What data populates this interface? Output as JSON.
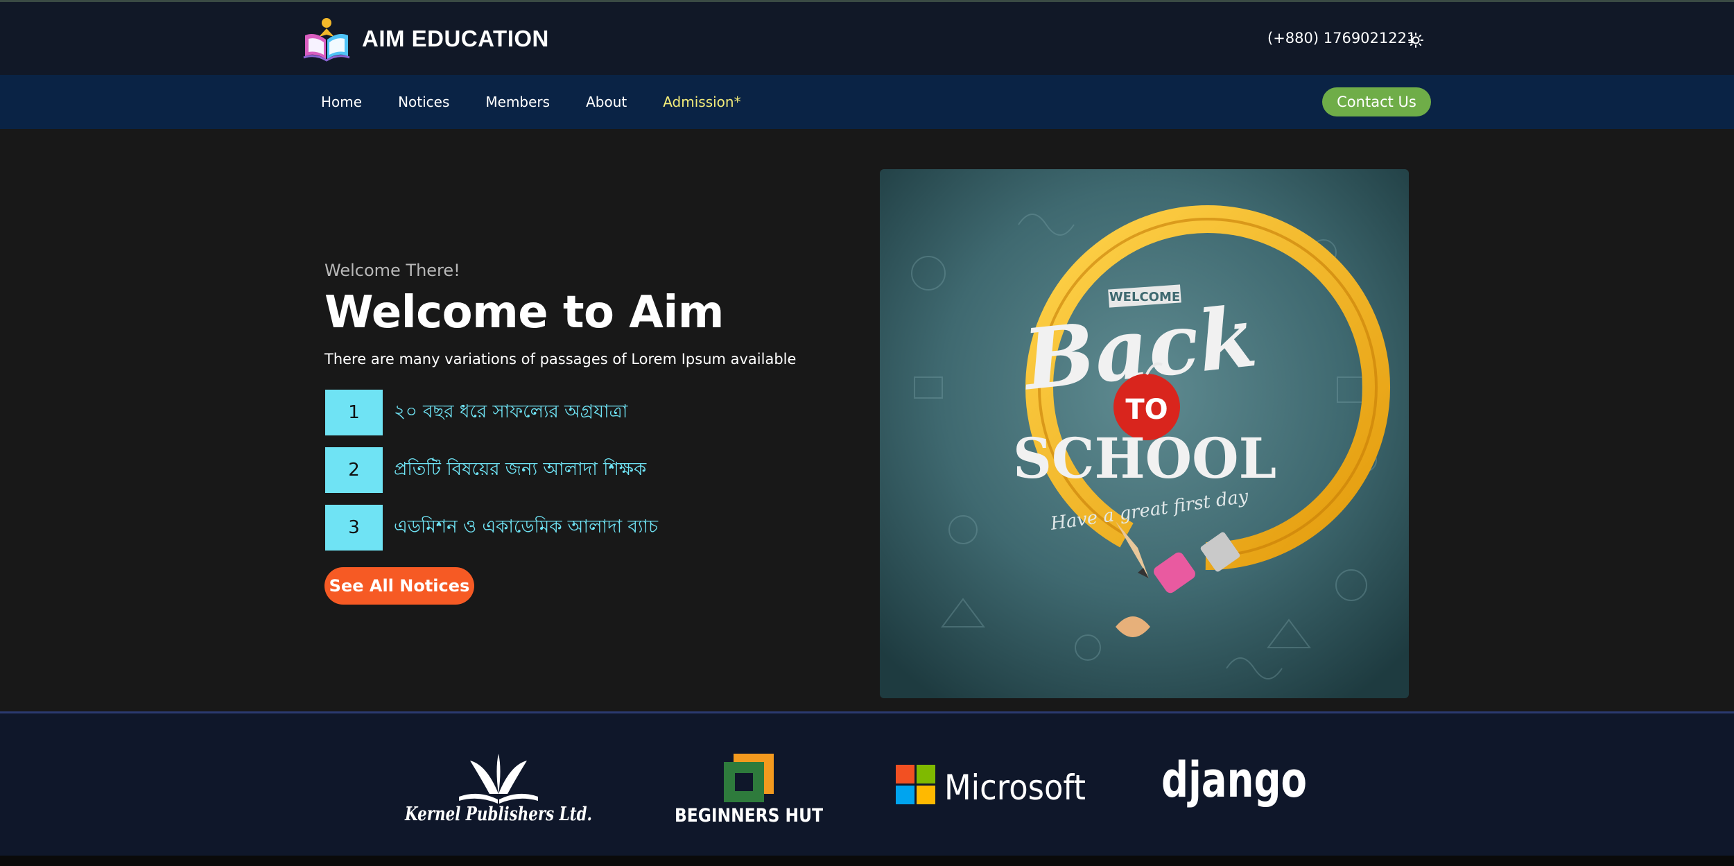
{
  "header": {
    "brand_name": "AIM EDUCATION",
    "phone": "(+880) 1769021221",
    "theme_icon": "sun-icon"
  },
  "nav": {
    "items": [
      {
        "label": "Home"
      },
      {
        "label": "Notices"
      },
      {
        "label": "Members"
      },
      {
        "label": "About"
      },
      {
        "label": "Admission*"
      }
    ],
    "contact_label": "Contact Us"
  },
  "hero": {
    "eyebrow": "Welcome There!",
    "title": "Welcome to Aim",
    "subtitle": "There are many variations of passages of Lorem Ipsum available",
    "features": [
      {
        "num": "1",
        "text": "২০ বছর ধরে সাফল্যের অগ্রযাত্রা"
      },
      {
        "num": "2",
        "text": "প্রতিটি বিষয়ের জন্য আলাদা শিক্ষক"
      },
      {
        "num": "3",
        "text": "এডমিশন ও একাডেমিক আলাদা ব্যাচ"
      }
    ],
    "button_label": "See All Notices",
    "poster": {
      "banner": "WELCOME",
      "line1": "Back",
      "line2": "TO",
      "line3": "SCHOOL",
      "tagline": "Have a great first day"
    }
  },
  "partners": {
    "kernel": {
      "name": "Kernel Publishers Ltd."
    },
    "beginners": {
      "name": "BEGINNERS HUT"
    },
    "microsoft": {
      "name": "Microsoft"
    },
    "django": {
      "name": "django"
    }
  },
  "colors": {
    "accent_cyan": "#6fe3f4",
    "orange": "#f65a24",
    "green": "#6fad48",
    "admission_yellow": "#f3ec7a"
  }
}
